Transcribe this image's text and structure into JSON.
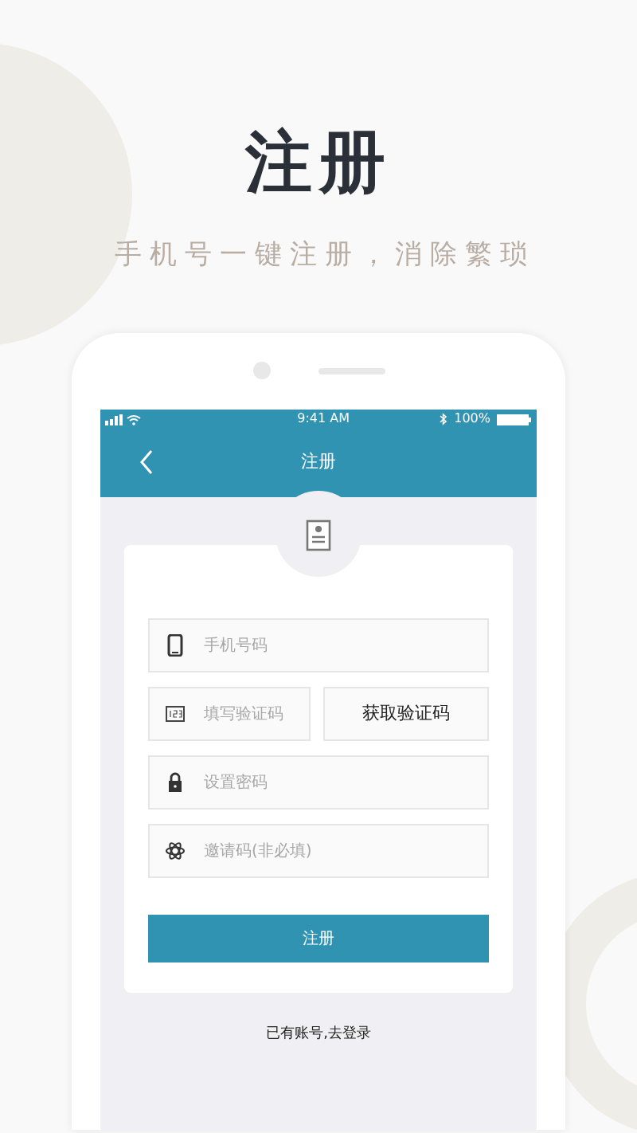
{
  "headline": "注册",
  "tagline": "手机号一键注册，消除繁琐",
  "status_bar": {
    "time": "9:41 AM",
    "battery": "100%"
  },
  "nav": {
    "title": "注册"
  },
  "fields": [
    {
      "kind": "phone",
      "placeholder": "手机号码"
    },
    {
      "kind": "code",
      "placeholder": "填写验证码",
      "button": "获取验证码"
    },
    {
      "kind": "password",
      "placeholder": "设置密码"
    },
    {
      "kind": "invite",
      "placeholder": "邀请码(非必填)"
    }
  ],
  "submit": "注册",
  "login_link": "已有账号,去登录"
}
